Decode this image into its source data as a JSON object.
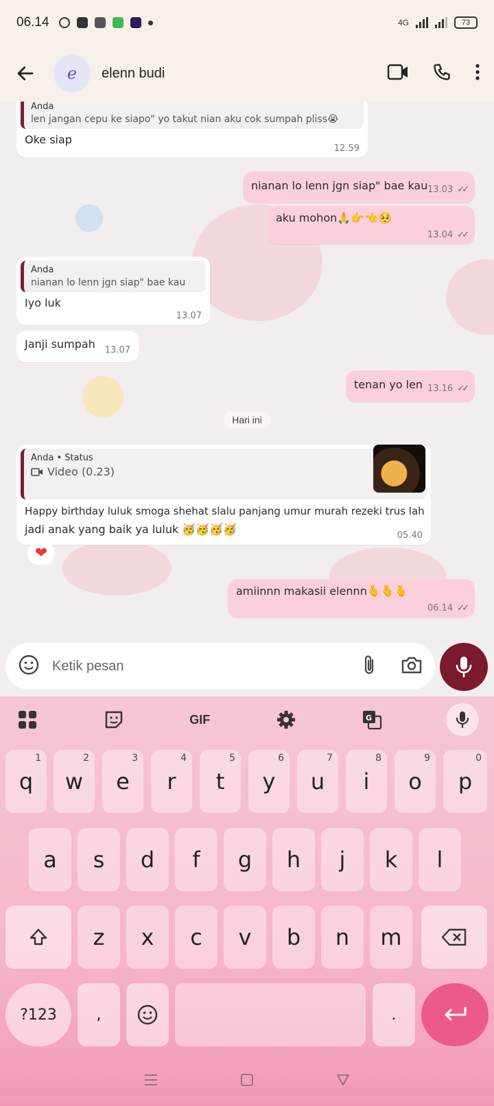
{
  "status_bar": {
    "time": "06.14",
    "network": "4G",
    "battery": "73"
  },
  "header": {
    "avatar_letter": "e",
    "contact_name": "elenn budi"
  },
  "messages": {
    "m1": {
      "quote_author": "Anda",
      "quote_text": "len jangan cepu ke siapo\" yo takut nian aku cok sumpah pliss😭",
      "text": "Oke siap",
      "time": "12.59"
    },
    "m2": {
      "text": "nianan lo lenn jgn siap\" bae kau",
      "time": "13.03"
    },
    "m3": {
      "text": "aku mohon🙏👉👈🥺",
      "time": "13.04"
    },
    "m4": {
      "quote_author": "Anda",
      "quote_text": "nianan lo lenn jgn siap\" bae kau",
      "text": "Iyo luk",
      "time": "13.07"
    },
    "m5": {
      "text": "Janji sumpah",
      "time": "13.07"
    },
    "m6": {
      "text": "tenan yo len",
      "time": "13.16"
    },
    "date_divider": "Hari ini",
    "m7": {
      "quote_author": "Anda • Status",
      "quote_text": "Video (0.23)",
      "text_line1": "Happy birthday luluk smoga shehat slalu panjang umur murah rezeki trus lah",
      "text_line2": "jadi anak yang baik ya luluk 🥳🥳🥳🥳",
      "time": "05.40",
      "reaction": "❤"
    },
    "m8": {
      "text": "amiinnn makasii elennn🫰🫰🫰",
      "time": "06.14"
    }
  },
  "composer": {
    "placeholder": "Ketik pesan"
  },
  "keyboard": {
    "toolbar": {
      "gif_label": "GIF"
    },
    "row1": [
      {
        "key": "q",
        "hint": "1"
      },
      {
        "key": "w",
        "hint": "2"
      },
      {
        "key": "e",
        "hint": "3"
      },
      {
        "key": "r",
        "hint": "4"
      },
      {
        "key": "t",
        "hint": "5"
      },
      {
        "key": "y",
        "hint": "6"
      },
      {
        "key": "u",
        "hint": "7"
      },
      {
        "key": "i",
        "hint": "8"
      },
      {
        "key": "o",
        "hint": "9"
      },
      {
        "key": "p",
        "hint": "0"
      }
    ],
    "row2": [
      "a",
      "s",
      "d",
      "f",
      "g",
      "h",
      "j",
      "k",
      "l"
    ],
    "row3": [
      "z",
      "x",
      "c",
      "v",
      "b",
      "n",
      "m"
    ],
    "symbols_label": "?123",
    "comma": ",",
    "period": "."
  },
  "colors": {
    "accent": "#7a1a2c",
    "outgoing_bubble": "#fbd0dc",
    "enter_key": "#ec5a8a"
  }
}
